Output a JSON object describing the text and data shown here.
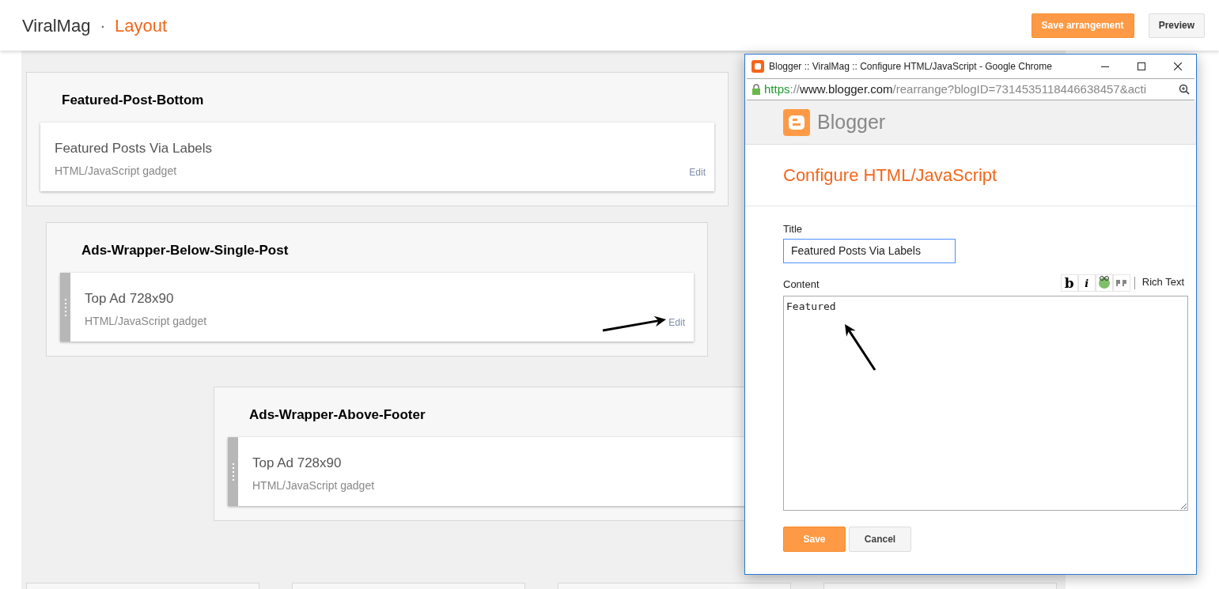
{
  "header": {
    "site": "ViralMag",
    "separator": "·",
    "page": "Layout",
    "buttons": [
      {
        "label": "Save arrangement",
        "kind": "primary"
      },
      {
        "label": "Preview",
        "kind": "secondary"
      }
    ]
  },
  "sections": [
    {
      "name": "Featured-Post-Bottom",
      "gadgets": [
        {
          "title": "Featured Posts Via Labels",
          "subtitle": "HTML/JavaScript gadget",
          "edit": "Edit",
          "draggable": false
        }
      ]
    },
    {
      "name": "Ads-Wrapper-Below-Single-Post",
      "gadgets": [
        {
          "title": "Top Ad 728x90",
          "subtitle": "HTML/JavaScript gadget",
          "edit": "Edit",
          "draggable": true
        }
      ]
    },
    {
      "name": "Ads-Wrapper-Above-Footer",
      "gadgets": [
        {
          "title": "Top Ad 728x90",
          "subtitle": "HTML/JavaScript gadget",
          "draggable": true
        }
      ]
    }
  ],
  "popup": {
    "window_title": "Blogger :: ViralMag :: Configure HTML/JavaScript - Google Chrome",
    "url": {
      "scheme": "https",
      "sep": "://",
      "host": "www.blogger.com",
      "path": "/rearrange?blogID=7314535118446638457&acti"
    },
    "brand": "Blogger",
    "heading": "Configure HTML/JavaScript",
    "title_label": "Title",
    "title_value": "Featured Posts Via Labels",
    "content_label": "Content",
    "tools": [
      {
        "kind": "bold",
        "glyph": "b"
      },
      {
        "kind": "italic",
        "glyph": "i"
      },
      {
        "kind": "link"
      },
      {
        "kind": "quote"
      }
    ],
    "rich_text": "Rich Text",
    "content_value": "Featured",
    "buttons": [
      {
        "label": "Save",
        "kind": "primary"
      },
      {
        "label": "Cancel",
        "kind": "secondary"
      }
    ]
  }
}
